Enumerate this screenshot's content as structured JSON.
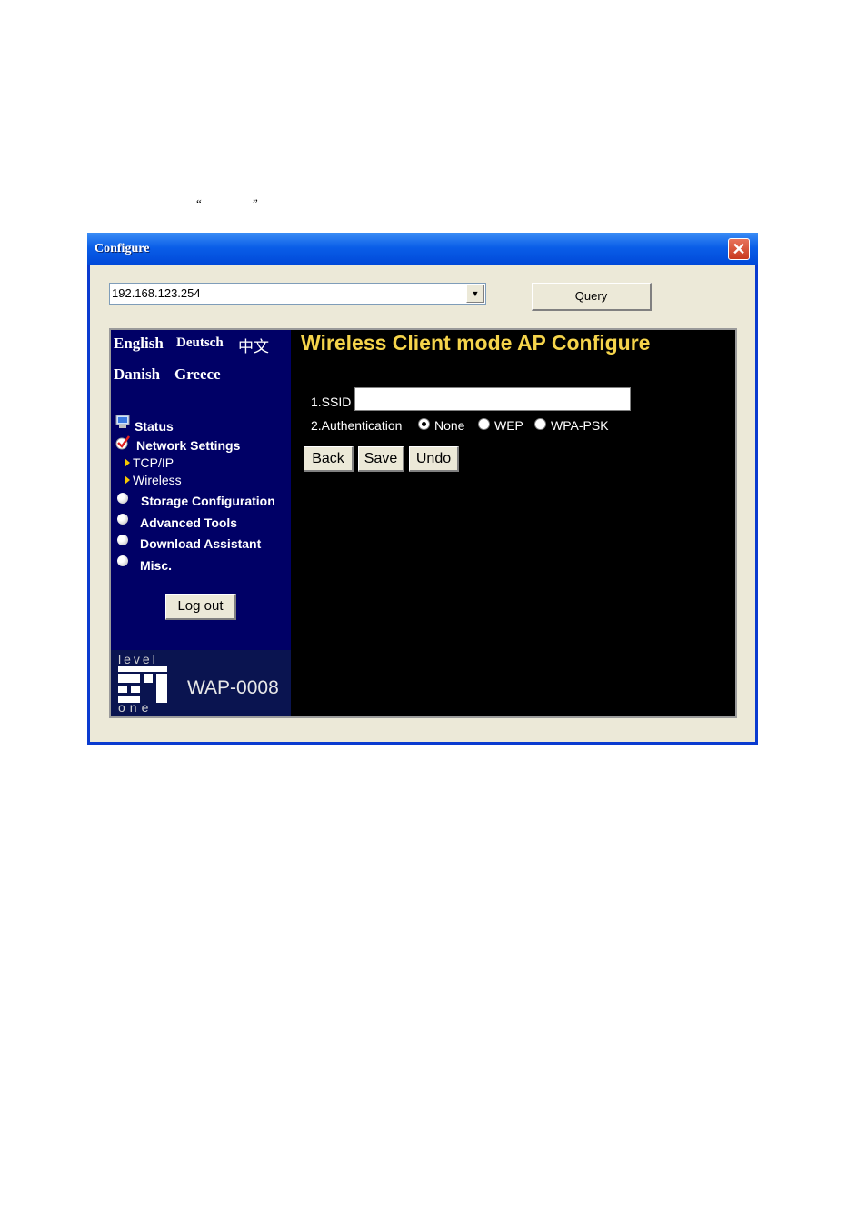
{
  "doc": {
    "open_quote": "“",
    "close_quote": "”"
  },
  "window": {
    "title": "Configure",
    "close_glyph": "✕"
  },
  "toolbar": {
    "ip_value": "192.168.123.254",
    "dropdown_glyph": "▼",
    "query_label": "Query"
  },
  "sidebar": {
    "languages": [
      "English",
      "Deutsch",
      "中文",
      "Danish",
      "Greece"
    ],
    "menu": {
      "status": "Status",
      "network_settings": "Network Settings",
      "tcpip": "TCP/IP",
      "wireless": "Wireless",
      "storage": "Storage Configuration",
      "advanced": "Advanced Tools",
      "download": "Download Assistant",
      "misc": "Misc."
    },
    "logout_label": "Log out",
    "logo": {
      "top": "level",
      "bottom": "one",
      "model": "WAP-0008"
    }
  },
  "content": {
    "title": "Wireless Client mode AP Configure",
    "ssid_label": "1.SSID",
    "ssid_value": "",
    "auth_label": "2.Authentication",
    "auth_options": [
      "None",
      "WEP",
      "WPA-PSK"
    ],
    "auth_selected": "None",
    "buttons": {
      "back": "Back",
      "save": "Save",
      "undo": "Undo"
    }
  },
  "colors": {
    "title_yellow": "#f5d44b",
    "sidebar_bg": "#000066",
    "titlebar_blue": "#0a5ee8"
  }
}
